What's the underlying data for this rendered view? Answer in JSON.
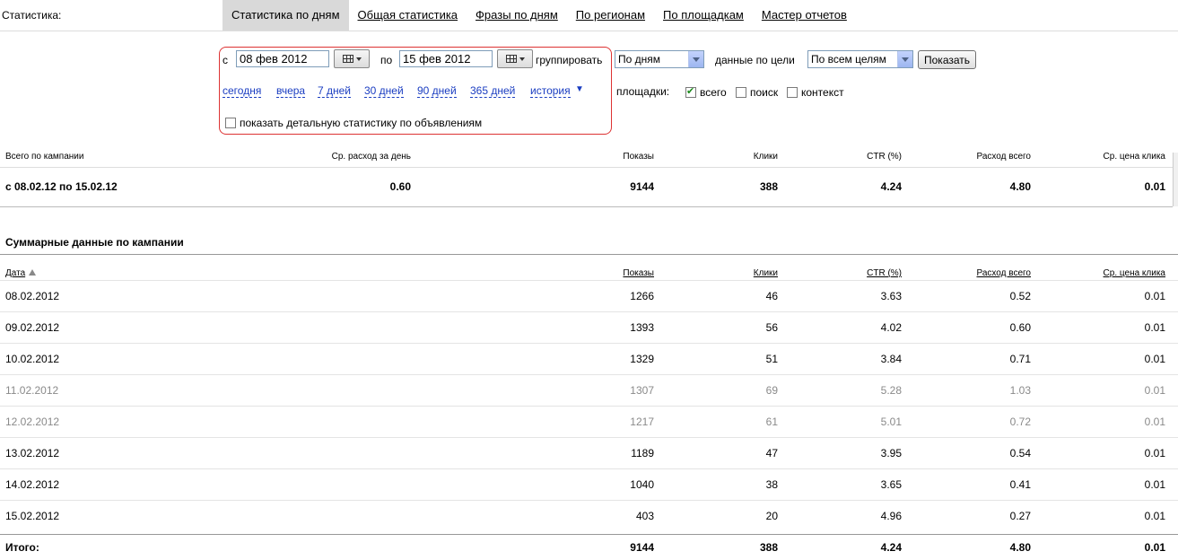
{
  "page": {
    "section_label": "Статистика:",
    "tabs": [
      {
        "label": "Статистика по дням",
        "active": true
      },
      {
        "label": "Общая статистика"
      },
      {
        "label": "Фразы по дням"
      },
      {
        "label": "По регионам"
      },
      {
        "label": "По площадкам"
      },
      {
        "label": "Мастер отчетов"
      }
    ]
  },
  "filters": {
    "from_label": "с",
    "from_value": "08 фев 2012",
    "to_label": "по",
    "to_value": "15 фев 2012",
    "calendar_icon": "calendar-icon",
    "group_label": "группировать",
    "group_value": "По дням",
    "goal_label": "данные по цели",
    "goal_value": "По всем целям",
    "show_button": "Показать",
    "quick_ranges": [
      "сегодня",
      "вчера",
      "7 дней",
      "30 дней",
      "90 дней",
      "365 дней",
      "история"
    ],
    "history_arrow": "▼",
    "sites_label": "площадки:",
    "sites": [
      {
        "label": "всего",
        "checked": true
      },
      {
        "label": "поиск",
        "checked": false
      },
      {
        "label": "контекст",
        "checked": false
      }
    ],
    "detail_label": "показать детальную статистику по объявлениям",
    "detail_checked": false
  },
  "summary": {
    "headers": {
      "period": "Всего по кампании",
      "avg_daily": "Ср. расход за день",
      "shows": "Показы",
      "clicks": "Клики",
      "ctr": "CTR (%)",
      "cost": "Расход всего",
      "avg_price": "Ср. цена клика"
    },
    "values": {
      "period": "с 08.02.12 по 15.02.12",
      "avg_daily": "0.60",
      "shows": "9144",
      "clicks": "388",
      "ctr": "4.24",
      "cost": "4.80",
      "avg_price": "0.01"
    }
  },
  "table": {
    "title": "Суммарные данные по кампании",
    "headers": {
      "date": "Дата",
      "shows": "Показы",
      "clicks": "Клики",
      "ctr": "CTR (%)",
      "cost": "Расход всего",
      "avg_price": "Ср. цена клика"
    },
    "rows": [
      {
        "date": "08.02.2012",
        "shows": "1266",
        "clicks": "46",
        "ctr": "3.63",
        "cost": "0.52",
        "avg_price": "0.01",
        "muted": false
      },
      {
        "date": "09.02.2012",
        "shows": "1393",
        "clicks": "56",
        "ctr": "4.02",
        "cost": "0.60",
        "avg_price": "0.01",
        "muted": false
      },
      {
        "date": "10.02.2012",
        "shows": "1329",
        "clicks": "51",
        "ctr": "3.84",
        "cost": "0.71",
        "avg_price": "0.01",
        "muted": false
      },
      {
        "date": "11.02.2012",
        "shows": "1307",
        "clicks": "69",
        "ctr": "5.28",
        "cost": "1.03",
        "avg_price": "0.01",
        "muted": true
      },
      {
        "date": "12.02.2012",
        "shows": "1217",
        "clicks": "61",
        "ctr": "5.01",
        "cost": "0.72",
        "avg_price": "0.01",
        "muted": true
      },
      {
        "date": "13.02.2012",
        "shows": "1189",
        "clicks": "47",
        "ctr": "3.95",
        "cost": "0.54",
        "avg_price": "0.01",
        "muted": false
      },
      {
        "date": "14.02.2012",
        "shows": "1040",
        "clicks": "38",
        "ctr": "3.65",
        "cost": "0.41",
        "avg_price": "0.01",
        "muted": false
      },
      {
        "date": "15.02.2012",
        "shows": "403",
        "clicks": "20",
        "ctr": "4.96",
        "cost": "0.27",
        "avg_price": "0.01",
        "muted": false
      }
    ],
    "total": {
      "label": "Итого:",
      "shows": "9144",
      "clicks": "388",
      "ctr": "4.24",
      "cost": "4.80",
      "avg_price": "0.01"
    }
  },
  "colors": {
    "link": "#1a3dc1",
    "active_tab_bg": "#d9d9d9",
    "highlight_border": "#dd3333",
    "muted_row_text": "#8a8a8a"
  }
}
